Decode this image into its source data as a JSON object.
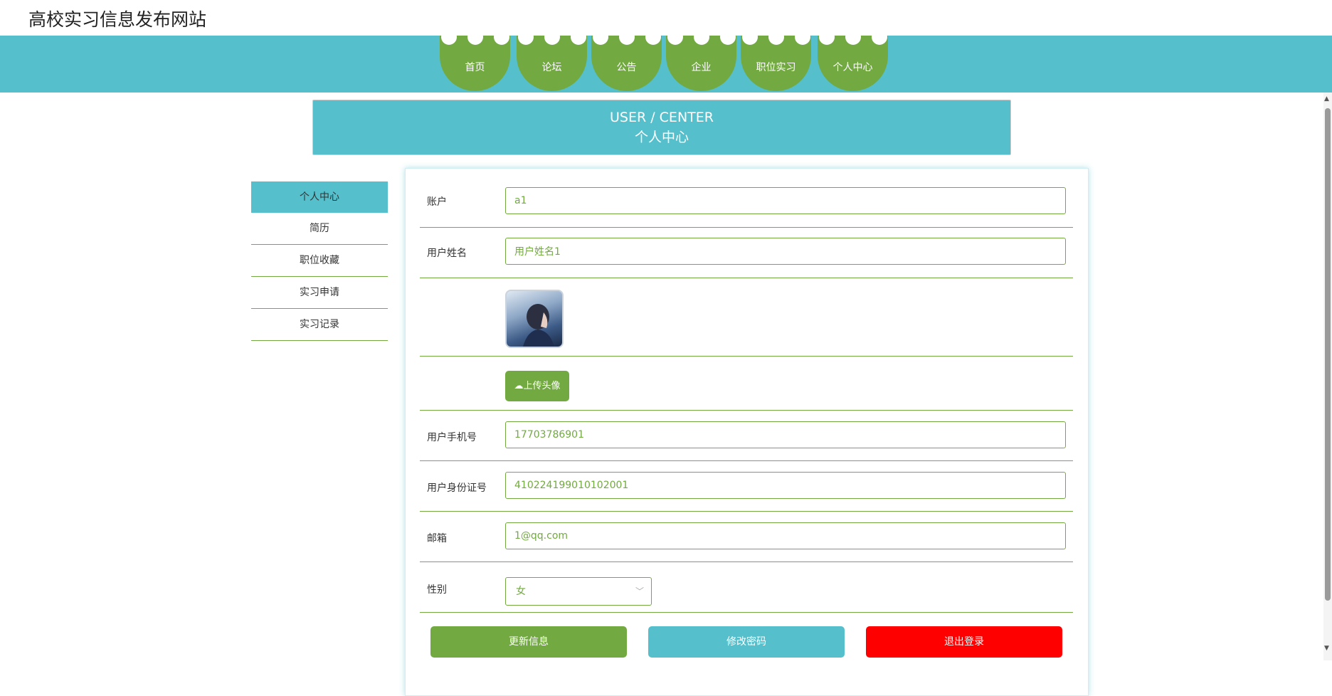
{
  "site": {
    "title": "高校实习信息发布网站"
  },
  "nav": {
    "items": [
      "首页",
      "论坛",
      "公告",
      "企业",
      "职位实习",
      "个人中心"
    ]
  },
  "banner": {
    "en": "USER / CENTER",
    "cn": "个人中心"
  },
  "sidebar": {
    "items": [
      "个人中心",
      "简历",
      "职位收藏",
      "实习申请",
      "实习记录"
    ],
    "active": "个人中心"
  },
  "form": {
    "account_label": "账户",
    "account_value": "a1",
    "name_label": "用户姓名",
    "name_value": "用户姓名1",
    "upload_label": "上传头像",
    "phone_label": "用户手机号",
    "phone_value": "17703786901",
    "idcard_label": "用户身份证号",
    "idcard_value": "410224199010102001",
    "email_label": "邮箱",
    "email_value": "1@qq.com",
    "gender_label": "性别",
    "gender_value": "女"
  },
  "actions": {
    "update": "更新信息",
    "password": "修改密码",
    "logout": "退出登录"
  },
  "colors": {
    "teal": "#55bfcb",
    "green": "#72aa41",
    "red": "#ff0000"
  }
}
